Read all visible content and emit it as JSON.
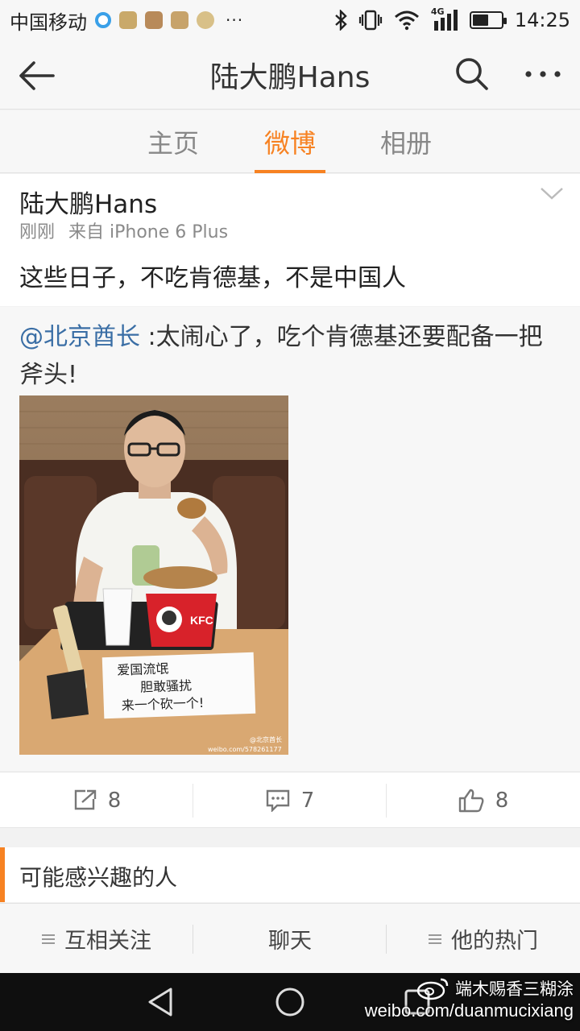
{
  "status_bar": {
    "carrier": "中国移动",
    "more_indicator": "···",
    "network": "4G",
    "time": "14:25",
    "battery_level": 0.55
  },
  "header": {
    "title": "陆大鹏Hans",
    "back_icon": "arrow-left-icon",
    "search_icon": "search-icon",
    "more_icon": "more-dots-icon"
  },
  "tabs": [
    {
      "label": "主页",
      "active": false
    },
    {
      "label": "微博",
      "active": true
    },
    {
      "label": "相册",
      "active": false
    }
  ],
  "post": {
    "author": "陆大鹏Hans",
    "time": "刚刚",
    "source": "来自 iPhone 6 Plus",
    "text": "这些日子，不吃肯德基，不是中国人",
    "retweet": {
      "mention": "@北京酋长",
      "text": " :太闹心了，吃个肯德基还要配备一把斧头!",
      "image": {
        "sign_text": [
          "爱国流氓",
          "胆敢骚扰",
          "来一个砍一个!"
        ],
        "bucket_label": "KFC",
        "watermark": "@北京酋长",
        "watermark_url": "weibo.com/578261177"
      }
    },
    "actions": [
      {
        "icon": "share-icon",
        "count": "8"
      },
      {
        "icon": "comment-icon",
        "count": "7"
      },
      {
        "icon": "like-icon",
        "count": "8"
      }
    ]
  },
  "interest_section": {
    "title": "可能感兴趣的人"
  },
  "toolbar": [
    {
      "label": "互相关注",
      "has_menu_icon": true
    },
    {
      "label": "聊天",
      "has_menu_icon": false
    },
    {
      "label": "他的热门",
      "has_menu_icon": true
    }
  ],
  "watermark": {
    "name": "端木赐香三糊涂",
    "url": "weibo.com/duanmucixiang"
  },
  "colors": {
    "accent": "#f78222",
    "link": "#3a6ea5"
  }
}
